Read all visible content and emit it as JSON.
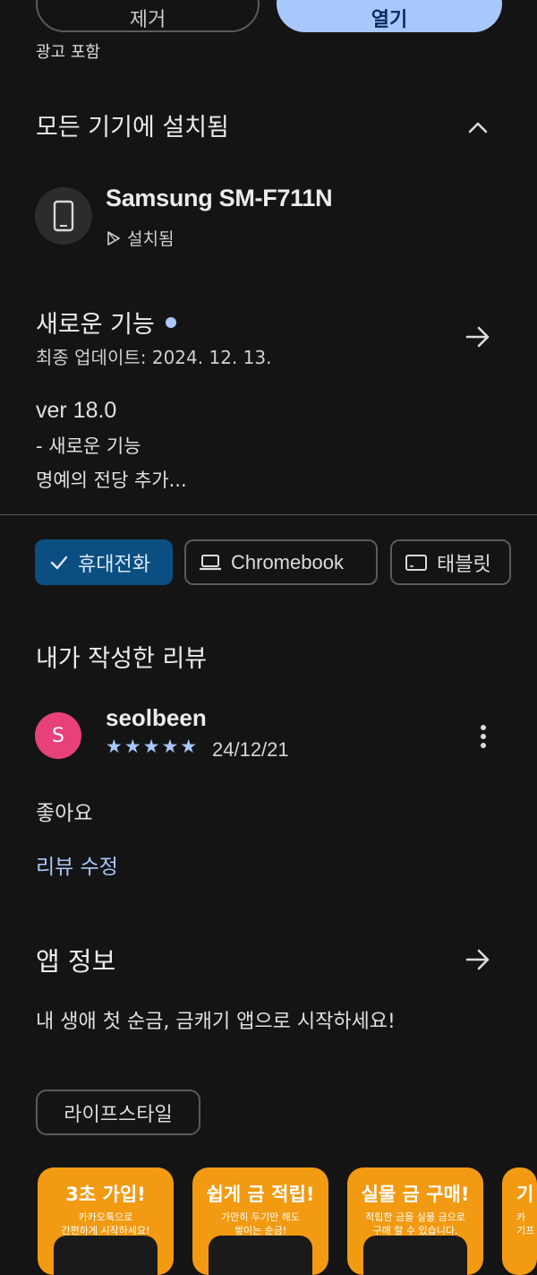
{
  "top_buttons": {
    "remove": "제거",
    "open": "열기"
  },
  "ad_label": "광고 포함",
  "installed": {
    "title": "모든 기기에 설치됨",
    "collapse_icon": "chevron-up-icon",
    "device_name": "Samsung SM-F711N",
    "device_status": "설치됨"
  },
  "whats_new": {
    "title": "새로운 기능",
    "updated": "최종 업데이트: 2024. 12. 13.",
    "version": "ver 18.0",
    "notes_line1": "- 새로운 기능",
    "notes_line2": "명예의 전당 추가..."
  },
  "device_chips": [
    "휴대전화",
    "Chromebook",
    "태블릿"
  ],
  "my_review": {
    "title": "내가 작성한 리뷰",
    "avatar_letter": "S",
    "avatar_color": "#e7407a",
    "user": "seolbeen",
    "stars": "★★★★★",
    "rating": 5,
    "date": "24/12/21",
    "text": "좋아요",
    "edit_label": "리뷰 수정"
  },
  "app_info": {
    "title": "앱 정보",
    "description": "내 생애 첫 순금, 금캐기 앱으로 시작하세요!",
    "category": "라이프스타일"
  },
  "screenshots": [
    {
      "headline": "3초 가입!",
      "sub1": "카카오톡으로",
      "sub2": "간편하게 시작하세요!"
    },
    {
      "headline": "쉽게 금 적립!",
      "sub1": "가만히 두기만 해도",
      "sub2": "쌓이는 순금!"
    },
    {
      "headline": "실물 금 구매!",
      "sub1": "적립한 금을 실물 금으로",
      "sub2": "구매 할 수 있습니다."
    },
    {
      "headline": "기",
      "sub1": "카",
      "sub2": "기프"
    }
  ],
  "colors": {
    "accent": "#a8c7fa",
    "background": "#141414",
    "chip_selected": "#0b4f82",
    "screenshot_bg": "#f29a12"
  }
}
